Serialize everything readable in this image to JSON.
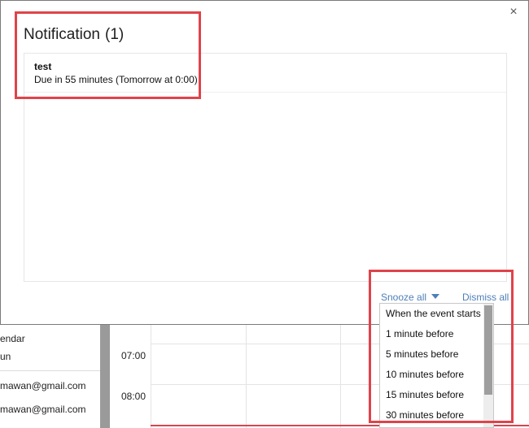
{
  "dialog": {
    "title": "Notification",
    "count": "(1)",
    "close_glyph": "×",
    "notifications": [
      {
        "title": "test",
        "subtitle": "Due in 55 minutes (Tomorrow at 0:00)"
      }
    ],
    "snooze_label": "Snooze all",
    "dismiss_label": "Dismiss all",
    "snooze_options": [
      "When the event starts",
      "1 minute before",
      "5 minutes before",
      "10 minutes before",
      "15 minutes before",
      "30 minutes before"
    ]
  },
  "background": {
    "sidebar_items": [
      "endar",
      "un",
      "mawan@gmail.com",
      "mawan@gmail.com"
    ],
    "times": [
      "07:00",
      "08:00"
    ]
  },
  "colors": {
    "link": "#4d7fb8",
    "annotation": "#e0434a",
    "current_time_line": "#d64550"
  },
  "icons": {
    "close": "close-icon",
    "dropdown_arrow": "chevron-down-icon"
  }
}
